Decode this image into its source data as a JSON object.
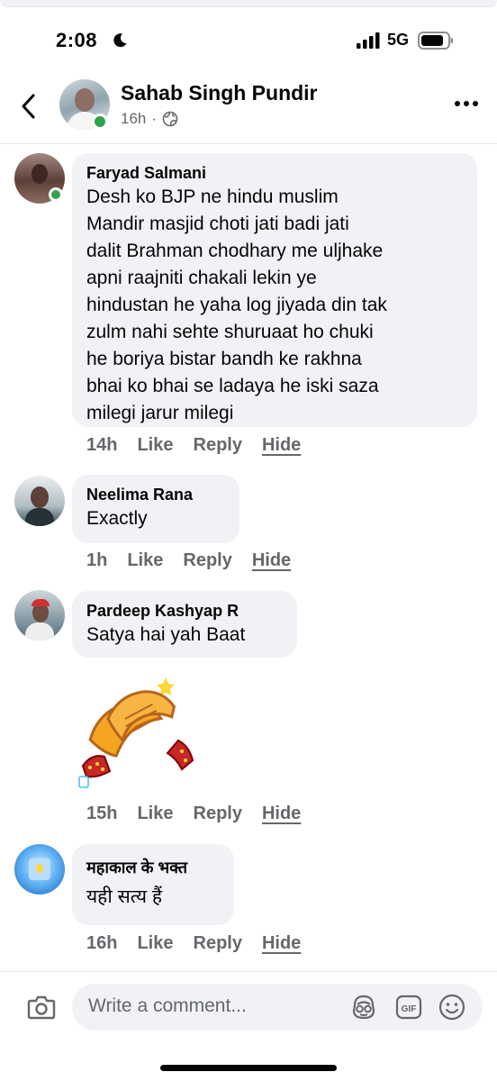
{
  "status_bar": {
    "time": "2:08",
    "network": "5G"
  },
  "header": {
    "name": "Sahab Singh Pundir",
    "time": "16h",
    "separator": "·"
  },
  "comments": [
    {
      "author": "Faryad Salmani",
      "text_lines": [
        "Desh ko BJP ne hindu muslim",
        "Mandir masjid choti jati badi jati",
        "dalit Brahman chodhary me uljhake",
        "apni raajniti chakali lekin ye",
        "hindustan he yaha log jiyada din tak",
        "zulm nahi sehte shuruaat ho chuki",
        "he boriya bistar bandh ke rakhna",
        "bhai ko bhai se ladaya he iski saza",
        "milegi jarur milegi"
      ],
      "time": "14h",
      "like": "Like",
      "reply": "Reply",
      "hide": "Hide"
    },
    {
      "author": "Neelima Rana",
      "text": "Exactly",
      "time": "1h",
      "like": "Like",
      "reply": "Reply",
      "hide": "Hide"
    },
    {
      "author": "Pardeep Kashyap R",
      "text": "Satya hai yah Baat",
      "sticker": "clapping-hands-sticker",
      "time": "15h",
      "like": "Like",
      "reply": "Reply",
      "hide": "Hide"
    },
    {
      "author": "महाकाल के भक्त",
      "text": "यही सत्य हैं",
      "time": "16h",
      "like": "Like",
      "reply": "Reply",
      "hide": "Hide"
    }
  ],
  "composer": {
    "placeholder": "Write a comment..."
  },
  "colors": {
    "bubble": "#f0f2f5",
    "online": "#31a24c",
    "meta_text": "#65676b"
  }
}
